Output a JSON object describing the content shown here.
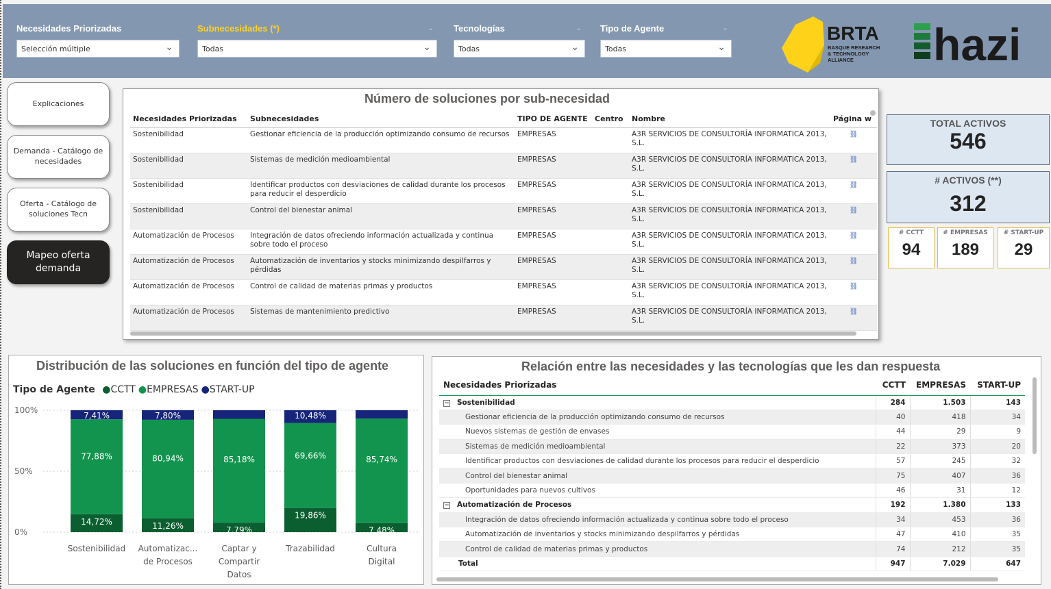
{
  "filters": [
    {
      "label": "Necesidades Priorizadas",
      "value": "Selección múltiple",
      "highlight": false
    },
    {
      "label": "Subnecesidades (*)",
      "value": "Todas",
      "highlight": true
    },
    {
      "label": "Tecnologías",
      "value": "Todas",
      "highlight": false
    },
    {
      "label": "Tipo de Agente",
      "value": "Todas",
      "highlight": false
    }
  ],
  "logos": {
    "brta_name": "BRTA",
    "brta_sub": [
      "BASQUE RESEARCH",
      "& TECHNOLOGY",
      "ALLIANCE"
    ],
    "hazi": "hazi"
  },
  "nav": [
    {
      "label": "Explicaciones",
      "active": false
    },
    {
      "label": "Demanda - Catálogo de necesidades",
      "active": false
    },
    {
      "label": "Oferta - Catálogo de soluciones Tecn",
      "active": false
    },
    {
      "label": "Mapeo oferta demanda",
      "active": true
    }
  ],
  "solutions_table": {
    "title": "Número de soluciones por sub-necesidad",
    "headers": [
      "Necesidades Priorizadas",
      "Subnecesidades",
      "TIPO DE AGENTE",
      "Centro",
      "Nombre",
      "Página w"
    ],
    "rows": [
      {
        "necesidad": "Sostenibilidad",
        "sub": "Gestionar eficiencia de la producción optimizando consumo de recursos",
        "tipo": "EMPRESAS",
        "centro": "",
        "nombre": "A3R SERVICIOS DE CONSULTORÍA INFORMATICA 2013, S.L."
      },
      {
        "necesidad": "Sostenibilidad",
        "sub": "Sistemas de medición medioambiental",
        "tipo": "EMPRESAS",
        "centro": "",
        "nombre": "A3R SERVICIOS DE CONSULTORÍA INFORMATICA 2013, S.L."
      },
      {
        "necesidad": "Sostenibilidad",
        "sub": "Identificar productos con desviaciones de calidad durante los procesos para reducir el desperdicio",
        "tipo": "EMPRESAS",
        "centro": "",
        "nombre": "A3R SERVICIOS DE CONSULTORÍA INFORMATICA 2013, S.L."
      },
      {
        "necesidad": "Sostenibilidad",
        "sub": "Control del bienestar animal",
        "tipo": "EMPRESAS",
        "centro": "",
        "nombre": "A3R SERVICIOS DE CONSULTORÍA INFORMATICA 2013, S.L."
      },
      {
        "necesidad": "Automatización de Procesos",
        "sub": "Integración de datos ofreciendo información actualizada y continua sobre todo el proceso",
        "tipo": "EMPRESAS",
        "centro": "",
        "nombre": "A3R SERVICIOS DE CONSULTORÍA INFORMATICA 2013, S.L."
      },
      {
        "necesidad": "Automatización de Procesos",
        "sub": "Automatización de inventarios y stocks minimizando despilfarros y pérdidas",
        "tipo": "EMPRESAS",
        "centro": "",
        "nombre": "A3R SERVICIOS DE CONSULTORÍA INFORMATICA 2013, S.L."
      },
      {
        "necesidad": "Automatización de Procesos",
        "sub": "Control de calidad de materias primas y productos",
        "tipo": "EMPRESAS",
        "centro": "",
        "nombre": "A3R SERVICIOS DE CONSULTORÍA INFORMATICA 2013, S.L."
      },
      {
        "necesidad": "Automatización de Procesos",
        "sub": "Sistemas de mantenimiento predictivo",
        "tipo": "EMPRESAS",
        "centro": "",
        "nombre": "A3R SERVICIOS DE CONSULTORÍA INFORMATICA 2013, S.L."
      }
    ]
  },
  "kpis": {
    "total_label": "TOTAL ACTIVOS",
    "total_value": "546",
    "activos_label": "# ACTIVOS (**)",
    "activos_value": "312",
    "mini": [
      {
        "label": "# CCTT",
        "value": "94"
      },
      {
        "label": "# EMPRESAS",
        "value": "189"
      },
      {
        "label": "# START-UP",
        "value": "29"
      }
    ]
  },
  "chart_data": {
    "type": "bar",
    "stacked": "100%",
    "title": "Distribución de las soluciones en función del tipo de agente",
    "legend_title": "Tipo de Agente",
    "legend_placement": "top-left",
    "categories": [
      [
        "Sostenibilidad"
      ],
      [
        "Automatizac...",
        "de Procesos"
      ],
      [
        "Captar y",
        "Compartir",
        "Datos"
      ],
      [
        "Trazabilidad"
      ],
      [
        "Cultura",
        "Digital"
      ]
    ],
    "y_ticks": [
      "100%",
      "50%",
      "0%"
    ],
    "ylim": [
      0,
      100
    ],
    "series": [
      {
        "name": "CCTT",
        "color": "#0b5e2f",
        "values": [
          14.72,
          11.26,
          7.79,
          19.86,
          7.48
        ],
        "labels": [
          "14,72%",
          "11,26%",
          "7,79%",
          "19,86%",
          "7,48%"
        ]
      },
      {
        "name": "EMPRESAS",
        "color": "#13944e",
        "values": [
          77.88,
          80.94,
          85.18,
          69.66,
          85.74
        ],
        "labels": [
          "77,88%",
          "80,94%",
          "85,18%",
          "69,66%",
          "85,74%"
        ]
      },
      {
        "name": "START-UP",
        "color": "#16247a",
        "values": [
          7.41,
          7.8,
          7.03,
          10.48,
          6.78
        ],
        "labels": [
          "7,41%",
          "7,80%",
          "",
          "10,48%",
          ""
        ]
      }
    ]
  },
  "matrix": {
    "title": "Relación entre las necesidades y las tecnologías que les dan respuesta",
    "headers": [
      "Necesidades Priorizadas",
      "CCTT",
      "EMPRESAS",
      "START-UP"
    ],
    "rows": [
      {
        "kind": "grp",
        "label": "Sostenibilidad",
        "v": [
          "284",
          "1.503",
          "143"
        ]
      },
      {
        "kind": "child",
        "label": "Gestionar eficiencia de la producción optimizando consumo de recursos",
        "v": [
          "40",
          "418",
          "34"
        ]
      },
      {
        "kind": "child",
        "label": "Nuevos sistemas de gestión de envases",
        "v": [
          "44",
          "29",
          "9"
        ]
      },
      {
        "kind": "child",
        "label": "Sistemas de medición medioambiental",
        "v": [
          "22",
          "373",
          "20"
        ]
      },
      {
        "kind": "child",
        "label": "Identificar productos con desviaciones de calidad durante los procesos para reducir el desperdicio",
        "v": [
          "57",
          "245",
          "32"
        ]
      },
      {
        "kind": "child",
        "label": "Control del bienestar animal",
        "v": [
          "75",
          "407",
          "36"
        ]
      },
      {
        "kind": "child",
        "label": "Oportunidades para nuevos cultivos",
        "v": [
          "46",
          "31",
          "12"
        ]
      },
      {
        "kind": "grp",
        "label": "Automatización de Procesos",
        "v": [
          "192",
          "1.380",
          "133"
        ]
      },
      {
        "kind": "child",
        "label": "Integración de datos ofreciendo información actualizada y continua sobre todo el proceso",
        "v": [
          "34",
          "453",
          "36"
        ]
      },
      {
        "kind": "child",
        "label": "Automatización de inventarios y stocks minimizando despilfarros y pérdidas",
        "v": [
          "47",
          "410",
          "35"
        ]
      },
      {
        "kind": "child",
        "label": "Control de calidad de materias primas y productos",
        "v": [
          "74",
          "212",
          "35"
        ]
      },
      {
        "kind": "tot",
        "label": "Total",
        "v": [
          "947",
          "7.029",
          "647"
        ]
      }
    ]
  },
  "colors": {
    "header_bg": "#8497b0",
    "accent_yellow": "#ffd21a",
    "kpi_bg": "#dde7f2"
  }
}
